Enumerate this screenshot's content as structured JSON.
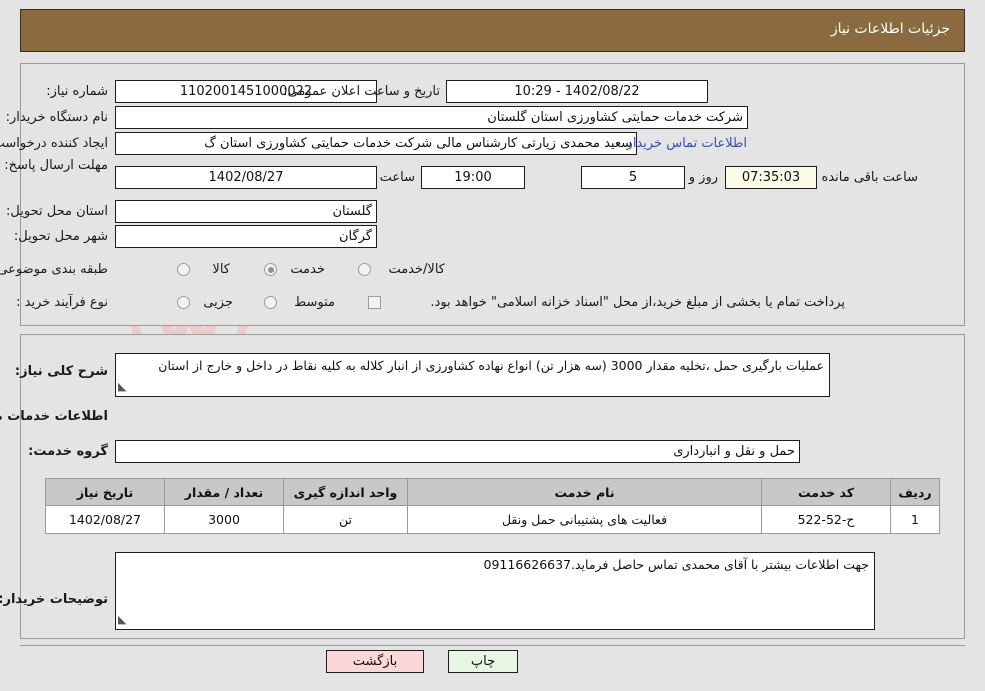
{
  "header": {
    "title": "جزئیات اطلاعات نیاز"
  },
  "top_form": {
    "need_number_label": "شماره نیاز:",
    "need_number_value": "1102001451000022",
    "announce_datetime_label": "تاریخ و ساعت اعلان عمومی:",
    "announce_datetime_value": "1402/08/22 - 10:29",
    "buyer_org_label": "نام دستگاه خریدار:",
    "buyer_org_value": "شرکت خدمات حمایتی کشاورزی استان گلستان",
    "requester_label": "ایجاد کننده درخواست:",
    "requester_value": "سعید محمدی زیارتی کارشناس مالی شرکت خدمات حمایتی کشاورزی استان گ",
    "contact_link": "اطلاعات تماس خریدار",
    "deadline_label": "مهلت ارسال پاسخ: تا تاریخ:",
    "deadline_date": "1402/08/27",
    "hour_label": "ساعت",
    "deadline_time": "19:00",
    "days_value": "5",
    "days_label": "روز و",
    "countdown_value": "07:35:03",
    "countdown_label": "ساعت باقی مانده",
    "province_label": "استان محل تحویل:",
    "province_value": "گلستان",
    "city_label": "شهر محل تحویل:",
    "city_value": "گرگان",
    "category_label": "طبقه بندی موضوعی:",
    "category_options": [
      {
        "label": "کالا",
        "selected": false
      },
      {
        "label": "خدمت",
        "selected": true
      },
      {
        "label": "کالا/خدمت",
        "selected": false
      }
    ],
    "process_label": "نوع فرآیند خرید :",
    "process_options": [
      {
        "label": "جزیی",
        "selected": false
      },
      {
        "label": "متوسط",
        "selected": false
      }
    ],
    "treasury_note": "پرداخت تمام یا بخشی از مبلغ خرید،از محل \"اسناد خزانه اسلامی\" خواهد بود."
  },
  "bottom": {
    "need_summary_label": "شرح کلی نیاز:",
    "need_summary_value": "عملیات بارگیری حمل ،تخلیه مقدار 3000 (سه هزار تن) انواع نهاده کشاورزی از انبار کلاله به کلیه نقاط در داخل و خارج از استان",
    "services_section_title": "اطلاعات خدمات مورد نیاز",
    "service_group_label": "گروه خدمت:",
    "service_group_value": "حمل و نقل و انبارداری",
    "table_headers": [
      "ردیف",
      "کد خدمت",
      "نام خدمت",
      "واحد اندازه گیری",
      "تعداد / مقدار",
      "تاریخ نیاز"
    ],
    "table_rows": [
      {
        "row": "1",
        "code": "ح-52-522",
        "name": "فعالیت های پشتیبانی حمل ونقل",
        "unit": "تن",
        "quantity": "3000",
        "date": "1402/08/27"
      }
    ],
    "buyer_notes_label": "توضیحات خریدار:",
    "buyer_notes_value": "جهت اطلاعات بیشتر با آقای محمدی تماس حاصل فرماید.09116626637"
  },
  "actions": {
    "back_label": "بازگشت",
    "print_label": "چاپ"
  },
  "watermark": {
    "text": "AriaTender.net"
  },
  "colors": {
    "header_bg": "#8a6a3f",
    "page_bg": "#e4e4e4",
    "link": "#2f54b8",
    "back_btn": "#fbd7d7",
    "print_btn": "#e8f7e4",
    "countdown_bg": "#fbfbe8",
    "table_header_bg": "#c8c8c8"
  }
}
